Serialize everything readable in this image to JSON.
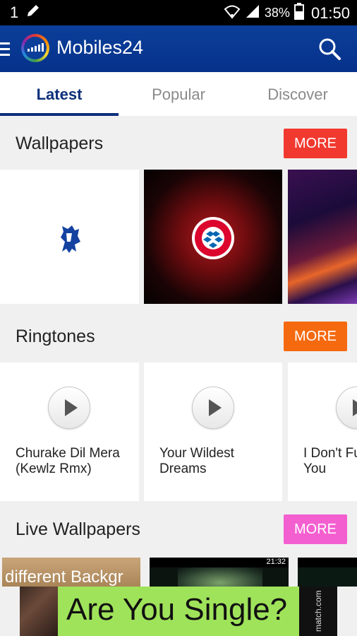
{
  "status_bar": {
    "notification_count": "1",
    "battery": "38%",
    "time": "01:50"
  },
  "app_bar": {
    "title": "Mobiles24"
  },
  "tabs": [
    {
      "label": "Latest",
      "active": true
    },
    {
      "label": "Popular",
      "active": false
    },
    {
      "label": "Discover",
      "active": false
    }
  ],
  "sections": {
    "wallpapers": {
      "title": "Wallpapers",
      "more_label": "MORE",
      "more_color": "#f2392f"
    },
    "ringtones": {
      "title": "Ringtones",
      "more_label": "MORE",
      "more_color": "#f56a0f",
      "items": [
        {
          "line1": "Churake Dil Mera",
          "line2": "(Kewlz Rmx)"
        },
        {
          "line1": "Your Wildest",
          "line2": "Dreams"
        },
        {
          "line1": "I Don't Fu",
          "line2": "You"
        }
      ]
    },
    "live_wallpapers": {
      "title": "Live Wallpapers",
      "more_label": "MORE",
      "more_color": "#f45fd0",
      "thumb_text": "different Backgr",
      "thumb_time": "21:32"
    }
  },
  "ad": {
    "headline": "Are You Single?",
    "brand": "match.com"
  },
  "colors": {
    "app_bar": "#0b3f9a",
    "tab_active": "#0b2f7a",
    "ad_background": "#9fe35a"
  }
}
